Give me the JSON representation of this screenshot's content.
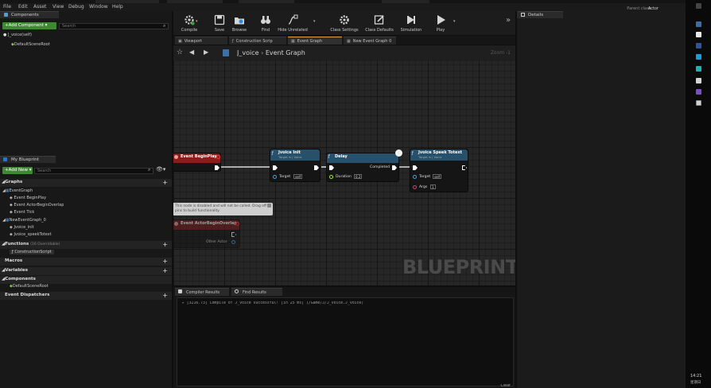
{
  "window": {
    "parent_class_label": "Parent class:",
    "parent_class_value": "Actor"
  },
  "menu": [
    "File",
    "Edit",
    "Asset",
    "View",
    "Debug",
    "Window",
    "Help"
  ],
  "components_panel": {
    "tab": "Components",
    "add_button": "+Add Component ▾",
    "search_placeholder": "Search",
    "self_item": "J_voice(self)",
    "items": [
      "DefaultSceneRoot"
    ]
  },
  "my_blueprint": {
    "tab": "My Blueprint",
    "add_button": "+Add New ▾",
    "search_placeholder": "Search",
    "graphs_label": "Graphs",
    "event_graph_label": "EventGraph",
    "event_graph_items": [
      "Event BeginPlay",
      "Event ActorBeginOverlap",
      "Event Tick"
    ],
    "new_event_graph_label": "NewEventGraph_0",
    "new_event_graph_items": [
      "Jvoice_init",
      "Jvoice_speekTotext"
    ],
    "functions_label": "Functions",
    "functions_count": "(16 Overridable)",
    "functions_items": [
      "ConstructionScript"
    ],
    "macros_label": "Macros",
    "variables_label": "Variables",
    "components_label": "Components",
    "components_items": [
      "DefaultSceneRoot"
    ],
    "dispatchers_label": "Event Dispatchers"
  },
  "toolbar": {
    "buttons": [
      "Compile",
      "Save",
      "Browse",
      "Find",
      "Hide Unrelated",
      "Class Settings",
      "Class Defaults",
      "Simulation",
      "Play"
    ],
    "overflow": "»"
  },
  "doc_tabs": [
    "Viewport",
    "Construction Scrip",
    "Event Graph",
    "New Event Graph 0"
  ],
  "graph": {
    "breadcrumb_bp": "J_voice",
    "breadcrumb_graph": "Event Graph",
    "zoom": "Zoom -1",
    "watermark": "BLUEPRINT",
    "disabled_note": "This node is disabled and will not be called. Drag off pins to build functionality.",
    "nodes": {
      "begin_play": {
        "title": "Event BeginPlay"
      },
      "jvoice_init": {
        "title": "Jvoice Init",
        "subtitle": "Target is J Voice",
        "target_label": "Target",
        "target_value": "self"
      },
      "delay": {
        "title": "Delay",
        "completed_label": "Completed",
        "duration_label": "Duration",
        "duration_value": "0.2"
      },
      "speek": {
        "title": "Jvoice Speek Totext",
        "subtitle": "Target is J Voice",
        "target_label": "Target",
        "target_value": "self",
        "args_label": "Args",
        "args_value": "1"
      },
      "overlap": {
        "title": "Event ActorBeginOverlap",
        "other_actor_label": "Other Actor"
      }
    }
  },
  "bottom": {
    "tabs": [
      "Compiler Results",
      "Find Results"
    ],
    "log_line": "[3216.73] Compile of J_voice successful! [in 25 ms] (/Game/J/J_voice.J_voice)",
    "clear_button": "Clear"
  },
  "details": {
    "tab": "Details"
  },
  "taskbar": {
    "time": "14:21",
    "day": "星期日"
  },
  "colors": {
    "event_header": "#8a1c1c",
    "function_header": "#27506a",
    "green_button": "#3e8a32",
    "accent": "#e5a33a"
  }
}
